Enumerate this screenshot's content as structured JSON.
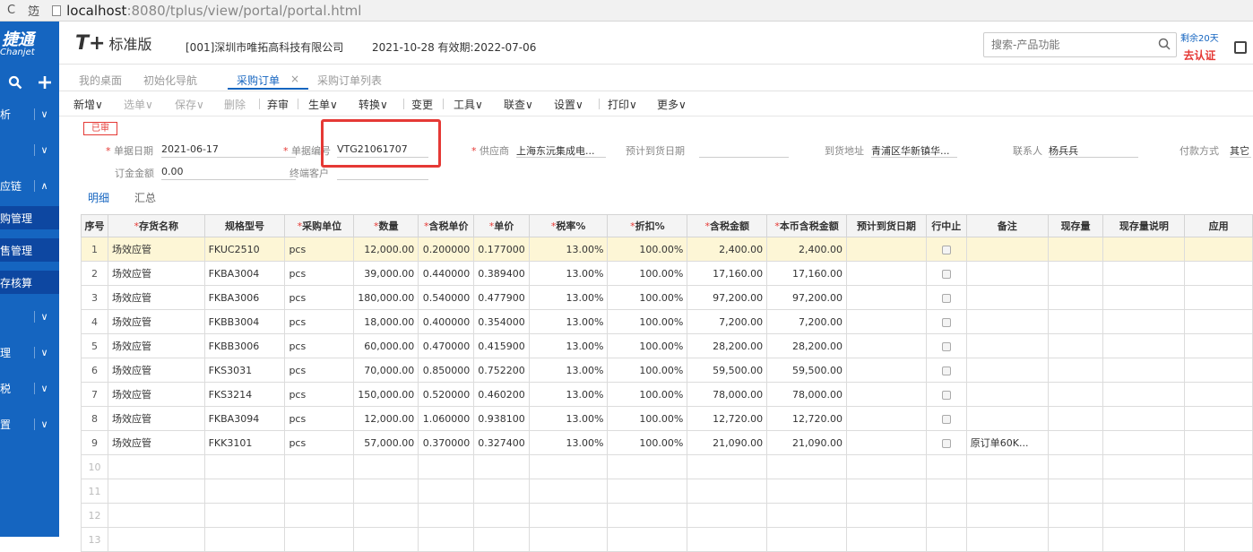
{
  "browser": {
    "reload_glyph": "C",
    "trash_glyph": "笾",
    "url_host": "localhost",
    "url_rest": ":8080/tplus/view/portal/portal.html"
  },
  "header": {
    "brand_cn": "捷通",
    "brand_en": "Chanjet",
    "logo_mark": "T+",
    "edition": "标准版",
    "company": "[001]深圳市唯拓高科技有限公司",
    "date_info": "2021-10-28   有效期:2022-07-06",
    "search_placeholder": "搜索-产品功能",
    "trial_days": "剩余20天",
    "trial_auth": "去认证"
  },
  "sidebar": {
    "items": [
      {
        "label": "析",
        "chev": "∨"
      },
      {
        "label": "",
        "chev": "∨"
      },
      {
        "label": "应链",
        "chev": "∧"
      },
      {
        "label": "",
        "chev": "∨"
      },
      {
        "label": "理",
        "chev": "∨"
      },
      {
        "label": "税",
        "chev": "∨"
      },
      {
        "label": "置",
        "chev": "∨"
      }
    ],
    "subs": [
      "购管理",
      "售管理",
      "存核算"
    ]
  },
  "tabs": {
    "t1": "我的桌面",
    "t2": "初始化导航",
    "t3": "采购订单",
    "t3_close": "×",
    "t4": "采购订单列表"
  },
  "toolbar": {
    "new": "新增",
    "select": "选单",
    "save": "保存",
    "delete": "删除",
    "unaudit": "弃审",
    "generate": "生单",
    "convert": "转换",
    "change": "变更",
    "tools": "工具",
    "query": "联查",
    "settings": "设置",
    "print": "打印",
    "more": "更多",
    "chev": "∨"
  },
  "form": {
    "status": "已审",
    "doc_date_label": "单据日期",
    "doc_date": "2021-06-17",
    "doc_no_label": "单据编号",
    "doc_no": "VTG21061707",
    "supplier_label": "供应商",
    "supplier": "上海东沅集成电...",
    "arrival_label": "预计到货日期",
    "address_label": "到货地址",
    "address": "青浦区华新镇华...",
    "contact_label": "联系人",
    "contact": "杨兵兵",
    "pay_label": "付款方式",
    "pay": "其它",
    "deposit_label": "订金金额",
    "deposit": "0.00",
    "end_customer_label": "终端客户",
    "req": "*"
  },
  "subtabs": {
    "detail": "明细",
    "summary": "汇总"
  },
  "grid": {
    "headers": [
      {
        "label": "序号",
        "req": false
      },
      {
        "label": "存货名称",
        "req": true
      },
      {
        "label": "规格型号",
        "req": false
      },
      {
        "label": "采购单位",
        "req": true
      },
      {
        "label": "数量",
        "req": true
      },
      {
        "label": "含税单价",
        "req": true
      },
      {
        "label": "单价",
        "req": true
      },
      {
        "label": "税率%",
        "req": true
      },
      {
        "label": "折扣%",
        "req": true
      },
      {
        "label": "含税金额",
        "req": true
      },
      {
        "label": "本币含税金额",
        "req": true
      },
      {
        "label": "预计到货日期",
        "req": false
      },
      {
        "label": "行中止",
        "req": false
      },
      {
        "label": "备注",
        "req": false
      },
      {
        "label": "现存量",
        "req": false
      },
      {
        "label": "现存量说明",
        "req": false
      },
      {
        "label": "应用",
        "req": false
      }
    ],
    "rows": [
      {
        "idx": "1",
        "name": "场效应管",
        "spec": "FKUC2510",
        "unit": "pcs",
        "qty": "12,000.00",
        "tax_price": "0.200000",
        "price": "0.177000",
        "tax_rate": "13.00%",
        "discount": "100.00%",
        "amount": "2,400.00",
        "local_amount": "2,400.00",
        "remark": ""
      },
      {
        "idx": "2",
        "name": "场效应管",
        "spec": "FKBA3004",
        "unit": "pcs",
        "qty": "39,000.00",
        "tax_price": "0.440000",
        "price": "0.389400",
        "tax_rate": "13.00%",
        "discount": "100.00%",
        "amount": "17,160.00",
        "local_amount": "17,160.00",
        "remark": ""
      },
      {
        "idx": "3",
        "name": "场效应管",
        "spec": "FKBA3006",
        "unit": "pcs",
        "qty": "180,000.00",
        "tax_price": "0.540000",
        "price": "0.477900",
        "tax_rate": "13.00%",
        "discount": "100.00%",
        "amount": "97,200.00",
        "local_amount": "97,200.00",
        "remark": ""
      },
      {
        "idx": "4",
        "name": "场效应管",
        "spec": "FKBB3004",
        "unit": "pcs",
        "qty": "18,000.00",
        "tax_price": "0.400000",
        "price": "0.354000",
        "tax_rate": "13.00%",
        "discount": "100.00%",
        "amount": "7,200.00",
        "local_amount": "7,200.00",
        "remark": ""
      },
      {
        "idx": "5",
        "name": "场效应管",
        "spec": "FKBB3006",
        "unit": "pcs",
        "qty": "60,000.00",
        "tax_price": "0.470000",
        "price": "0.415900",
        "tax_rate": "13.00%",
        "discount": "100.00%",
        "amount": "28,200.00",
        "local_amount": "28,200.00",
        "remark": ""
      },
      {
        "idx": "6",
        "name": "场效应管",
        "spec": "FKS3031",
        "unit": "pcs",
        "qty": "70,000.00",
        "tax_price": "0.850000",
        "price": "0.752200",
        "tax_rate": "13.00%",
        "discount": "100.00%",
        "amount": "59,500.00",
        "local_amount": "59,500.00",
        "remark": ""
      },
      {
        "idx": "7",
        "name": "场效应管",
        "spec": "FKS3214",
        "unit": "pcs",
        "qty": "150,000.00",
        "tax_price": "0.520000",
        "price": "0.460200",
        "tax_rate": "13.00%",
        "discount": "100.00%",
        "amount": "78,000.00",
        "local_amount": "78,000.00",
        "remark": ""
      },
      {
        "idx": "8",
        "name": "场效应管",
        "spec": "FKBA3094",
        "unit": "pcs",
        "qty": "12,000.00",
        "tax_price": "1.060000",
        "price": "0.938100",
        "tax_rate": "13.00%",
        "discount": "100.00%",
        "amount": "12,720.00",
        "local_amount": "12,720.00",
        "remark": ""
      },
      {
        "idx": "9",
        "name": "场效应管",
        "spec": "FKK3101",
        "unit": "pcs",
        "qty": "57,000.00",
        "tax_price": "0.370000",
        "price": "0.327400",
        "tax_rate": "13.00%",
        "discount": "100.00%",
        "amount": "21,090.00",
        "local_amount": "21,090.00",
        "remark": "原订单60K..."
      }
    ],
    "empty_rows": [
      "10",
      "11",
      "12",
      "13"
    ]
  },
  "colors": {
    "brand_blue": "#1565c0",
    "highlight_red": "#e53935",
    "selected_row": "#fdf6d6"
  },
  "icons": [
    "search-icon",
    "exit-icon",
    "plus-icon",
    "chevron-down-icon",
    "close-icon",
    "checkbox-icon"
  ]
}
